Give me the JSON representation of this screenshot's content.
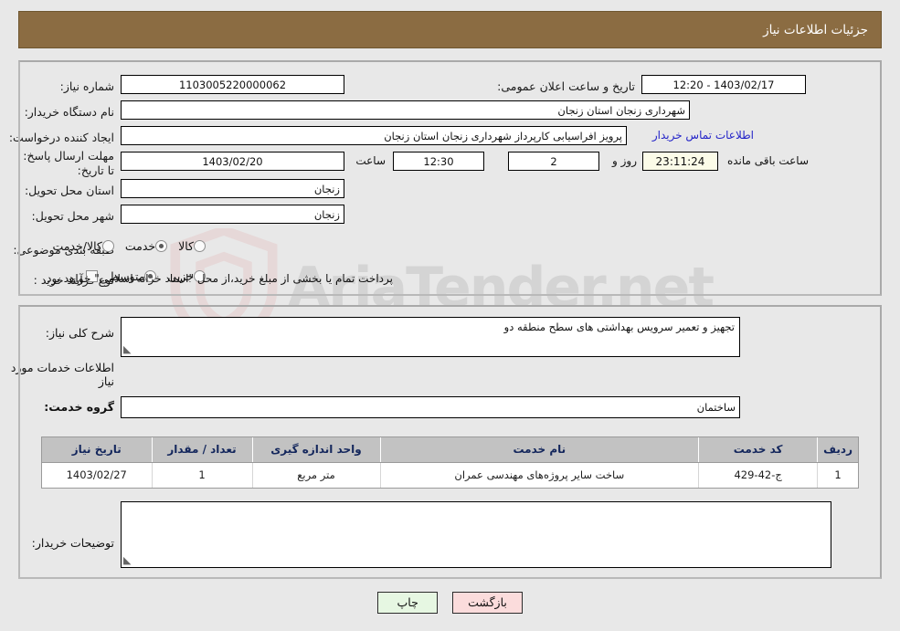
{
  "header": {
    "title": "جزئیات اطلاعات نیاز",
    "bar_color": "#8b6c42"
  },
  "watermark": {
    "text": "AriaTender.net",
    "shield_color": "#e8c4c4"
  },
  "top_panel": {
    "need_number_label": "شماره نیاز:",
    "need_number_value": "1103005220000062",
    "announce_label": "تاریخ و ساعت اعلان عمومی:",
    "announce_value": "1403/02/17 - 12:20",
    "buyer_org_label": "نام دستگاه خریدار:",
    "buyer_org_value": "شهرداری زنجان استان زنجان",
    "creator_label": "ایجاد کننده درخواست:",
    "creator_value": "پرویز افراسیابی کارپرداز شهرداری زنجان استان زنجان",
    "contact_link": "اطلاعات تماس خریدار",
    "deadline_label": "مهلت ارسال پاسخ: تا تاریخ:",
    "deadline_date": "1403/02/20",
    "hour_label": "ساعت",
    "deadline_time": "12:30",
    "days_value": "2",
    "days_word": "روز و",
    "timer_value": "23:11:24",
    "timer_suffix": "ساعت باقی مانده",
    "province_label": "استان محل تحویل:",
    "province_value": "زنجان",
    "city_label": "شهر محل تحویل:",
    "city_value": "زنجان",
    "category_label": "طبقه بندی موضوعی:",
    "category_options": [
      {
        "label": "کالا",
        "checked": false
      },
      {
        "label": "خدمت",
        "checked": true
      },
      {
        "label": "کالا/خدمت",
        "checked": false
      }
    ],
    "process_label": "نوع فرآیند خرید :",
    "process_options": [
      {
        "label": "جزیی",
        "checked": false
      },
      {
        "label": "متوسط",
        "checked": true
      }
    ],
    "treasury_note": "پرداخت تمام یا بخشی از مبلغ خرید،از محل \"اسناد خزانه اسلامی\" خواهد بود."
  },
  "mid_panel": {
    "summary_label": "شرح کلی نیاز:",
    "summary_value": "تجهیز و تعمیر سرویس بهداشتی های  سطح منطقه دو",
    "services_heading": "اطلاعات خدمات مورد نیاز",
    "service_group_label": "گروه خدمت:",
    "service_group_value": "ساختمان",
    "buyer_notes_label": "توضیحات خریدار:",
    "buyer_notes_value": ""
  },
  "table": {
    "columns": [
      "ردیف",
      "کد خدمت",
      "نام خدمت",
      "واحد اندازه گیری",
      "تعداد / مقدار",
      "تاریخ نیاز"
    ],
    "rows": [
      {
        "row": "1",
        "code": "ج-42-429",
        "name": "ساخت سایر پروژه‌های مهندسی عمران",
        "unit": "متر مربع",
        "qty": "1",
        "date": "1403/02/27"
      }
    ]
  },
  "buttons": {
    "back": "بازگشت",
    "print": "چاپ"
  }
}
